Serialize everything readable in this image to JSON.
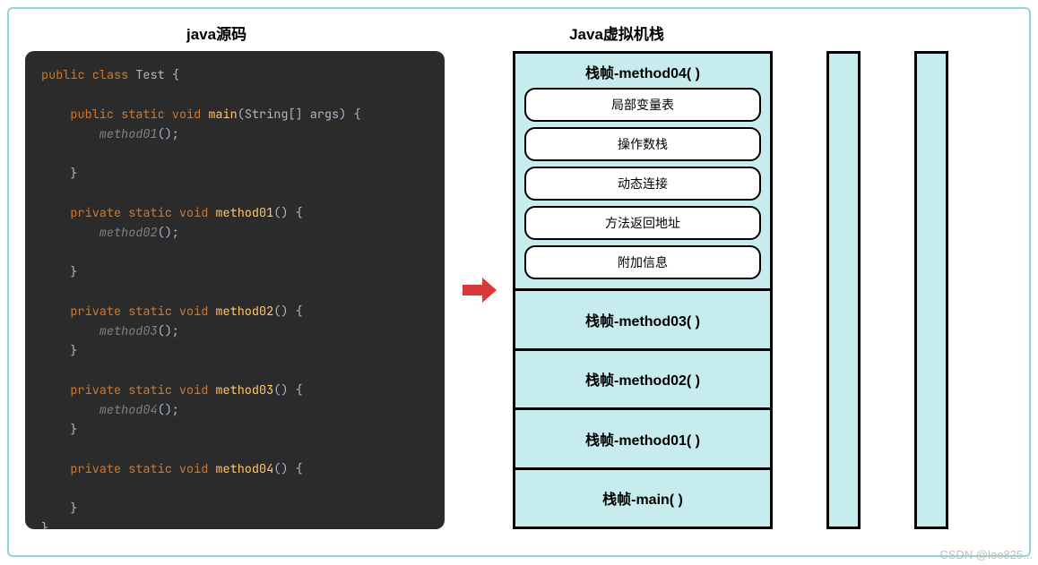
{
  "headings": {
    "left": "java源码",
    "right": "Java虚拟机栈"
  },
  "code": {
    "lines": [
      [
        {
          "t": "public ",
          "c": "kw"
        },
        {
          "t": "class ",
          "c": "kw"
        },
        {
          "t": "Test ",
          "c": "cls"
        },
        {
          "t": "{",
          "c": "bracket"
        }
      ],
      [
        {
          "t": "",
          "c": ""
        }
      ],
      [
        {
          "t": "    public static void ",
          "c": "kw"
        },
        {
          "t": "main",
          "c": "fn"
        },
        {
          "t": "(",
          "c": "pn"
        },
        {
          "t": "String",
          "c": "type"
        },
        {
          "t": "[] args) {",
          "c": "pn"
        }
      ],
      [
        {
          "t": "        method01",
          "c": "ital"
        },
        {
          "t": "();",
          "c": "pn"
        }
      ],
      [
        {
          "t": "",
          "c": ""
        }
      ],
      [
        {
          "t": "    }",
          "c": "bracket"
        }
      ],
      [
        {
          "t": "",
          "c": ""
        }
      ],
      [
        {
          "t": "    private static void ",
          "c": "kw"
        },
        {
          "t": "method01",
          "c": "fn"
        },
        {
          "t": "() {",
          "c": "pn"
        }
      ],
      [
        {
          "t": "        method02",
          "c": "ital"
        },
        {
          "t": "();",
          "c": "pn"
        }
      ],
      [
        {
          "t": "",
          "c": ""
        }
      ],
      [
        {
          "t": "    }",
          "c": "bracket"
        }
      ],
      [
        {
          "t": "",
          "c": ""
        }
      ],
      [
        {
          "t": "    private static void ",
          "c": "kw"
        },
        {
          "t": "method02",
          "c": "fn"
        },
        {
          "t": "() {",
          "c": "pn"
        }
      ],
      [
        {
          "t": "        method03",
          "c": "ital"
        },
        {
          "t": "();",
          "c": "pn"
        }
      ],
      [
        {
          "t": "    }",
          "c": "bracket"
        }
      ],
      [
        {
          "t": "",
          "c": ""
        }
      ],
      [
        {
          "t": "    private static void ",
          "c": "kw"
        },
        {
          "t": "method03",
          "c": "fn"
        },
        {
          "t": "() {",
          "c": "pn"
        }
      ],
      [
        {
          "t": "        method04",
          "c": "ital"
        },
        {
          "t": "();",
          "c": "pn"
        }
      ],
      [
        {
          "t": "    }",
          "c": "bracket"
        }
      ],
      [
        {
          "t": "",
          "c": ""
        }
      ],
      [
        {
          "t": "    private static void ",
          "c": "kw"
        },
        {
          "t": "method04",
          "c": "fn"
        },
        {
          "t": "() {",
          "c": "pn"
        }
      ],
      [
        {
          "t": "",
          "c": ""
        }
      ],
      [
        {
          "t": "    }",
          "c": "bracket"
        }
      ],
      [
        {
          "t": "}",
          "c": "bracket"
        }
      ]
    ]
  },
  "stack": {
    "top": {
      "title": "栈帧-method04( )",
      "items": [
        "局部变量表",
        "操作数栈",
        "动态连接",
        "方法返回地址",
        "附加信息"
      ]
    },
    "frames": [
      "栈帧-method03( )",
      "栈帧-method02( )",
      "栈帧-method01( )",
      "栈帧-main( )"
    ]
  },
  "watermark": "CSDN @leo825..."
}
